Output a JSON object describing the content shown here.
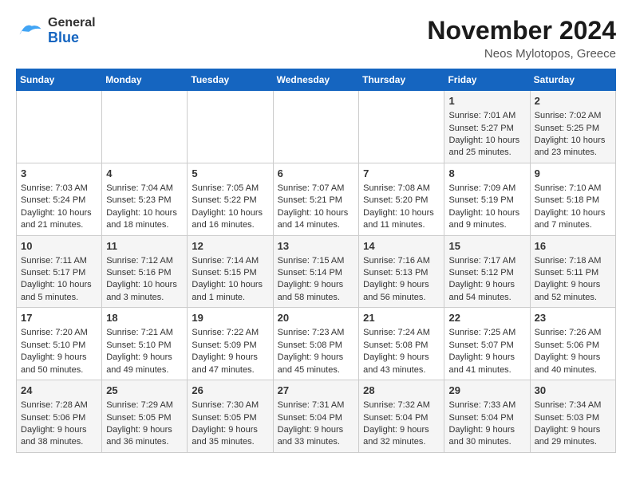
{
  "header": {
    "logo_general": "General",
    "logo_blue": "Blue",
    "month_year": "November 2024",
    "location": "Neos Mylotopos, Greece"
  },
  "days_of_week": [
    "Sunday",
    "Monday",
    "Tuesday",
    "Wednesday",
    "Thursday",
    "Friday",
    "Saturday"
  ],
  "weeks": [
    {
      "cells": [
        {
          "day": "",
          "content": ""
        },
        {
          "day": "",
          "content": ""
        },
        {
          "day": "",
          "content": ""
        },
        {
          "day": "",
          "content": ""
        },
        {
          "day": "",
          "content": ""
        },
        {
          "day": "1",
          "content": "Sunrise: 7:01 AM\nSunset: 5:27 PM\nDaylight: 10 hours and 25 minutes."
        },
        {
          "day": "2",
          "content": "Sunrise: 7:02 AM\nSunset: 5:25 PM\nDaylight: 10 hours and 23 minutes."
        }
      ]
    },
    {
      "cells": [
        {
          "day": "3",
          "content": "Sunrise: 7:03 AM\nSunset: 5:24 PM\nDaylight: 10 hours and 21 minutes."
        },
        {
          "day": "4",
          "content": "Sunrise: 7:04 AM\nSunset: 5:23 PM\nDaylight: 10 hours and 18 minutes."
        },
        {
          "day": "5",
          "content": "Sunrise: 7:05 AM\nSunset: 5:22 PM\nDaylight: 10 hours and 16 minutes."
        },
        {
          "day": "6",
          "content": "Sunrise: 7:07 AM\nSunset: 5:21 PM\nDaylight: 10 hours and 14 minutes."
        },
        {
          "day": "7",
          "content": "Sunrise: 7:08 AM\nSunset: 5:20 PM\nDaylight: 10 hours and 11 minutes."
        },
        {
          "day": "8",
          "content": "Sunrise: 7:09 AM\nSunset: 5:19 PM\nDaylight: 10 hours and 9 minutes."
        },
        {
          "day": "9",
          "content": "Sunrise: 7:10 AM\nSunset: 5:18 PM\nDaylight: 10 hours and 7 minutes."
        }
      ]
    },
    {
      "cells": [
        {
          "day": "10",
          "content": "Sunrise: 7:11 AM\nSunset: 5:17 PM\nDaylight: 10 hours and 5 minutes."
        },
        {
          "day": "11",
          "content": "Sunrise: 7:12 AM\nSunset: 5:16 PM\nDaylight: 10 hours and 3 minutes."
        },
        {
          "day": "12",
          "content": "Sunrise: 7:14 AM\nSunset: 5:15 PM\nDaylight: 10 hours and 1 minute."
        },
        {
          "day": "13",
          "content": "Sunrise: 7:15 AM\nSunset: 5:14 PM\nDaylight: 9 hours and 58 minutes."
        },
        {
          "day": "14",
          "content": "Sunrise: 7:16 AM\nSunset: 5:13 PM\nDaylight: 9 hours and 56 minutes."
        },
        {
          "day": "15",
          "content": "Sunrise: 7:17 AM\nSunset: 5:12 PM\nDaylight: 9 hours and 54 minutes."
        },
        {
          "day": "16",
          "content": "Sunrise: 7:18 AM\nSunset: 5:11 PM\nDaylight: 9 hours and 52 minutes."
        }
      ]
    },
    {
      "cells": [
        {
          "day": "17",
          "content": "Sunrise: 7:20 AM\nSunset: 5:10 PM\nDaylight: 9 hours and 50 minutes."
        },
        {
          "day": "18",
          "content": "Sunrise: 7:21 AM\nSunset: 5:10 PM\nDaylight: 9 hours and 49 minutes."
        },
        {
          "day": "19",
          "content": "Sunrise: 7:22 AM\nSunset: 5:09 PM\nDaylight: 9 hours and 47 minutes."
        },
        {
          "day": "20",
          "content": "Sunrise: 7:23 AM\nSunset: 5:08 PM\nDaylight: 9 hours and 45 minutes."
        },
        {
          "day": "21",
          "content": "Sunrise: 7:24 AM\nSunset: 5:08 PM\nDaylight: 9 hours and 43 minutes."
        },
        {
          "day": "22",
          "content": "Sunrise: 7:25 AM\nSunset: 5:07 PM\nDaylight: 9 hours and 41 minutes."
        },
        {
          "day": "23",
          "content": "Sunrise: 7:26 AM\nSunset: 5:06 PM\nDaylight: 9 hours and 40 minutes."
        }
      ]
    },
    {
      "cells": [
        {
          "day": "24",
          "content": "Sunrise: 7:28 AM\nSunset: 5:06 PM\nDaylight: 9 hours and 38 minutes."
        },
        {
          "day": "25",
          "content": "Sunrise: 7:29 AM\nSunset: 5:05 PM\nDaylight: 9 hours and 36 minutes."
        },
        {
          "day": "26",
          "content": "Sunrise: 7:30 AM\nSunset: 5:05 PM\nDaylight: 9 hours and 35 minutes."
        },
        {
          "day": "27",
          "content": "Sunrise: 7:31 AM\nSunset: 5:04 PM\nDaylight: 9 hours and 33 minutes."
        },
        {
          "day": "28",
          "content": "Sunrise: 7:32 AM\nSunset: 5:04 PM\nDaylight: 9 hours and 32 minutes."
        },
        {
          "day": "29",
          "content": "Sunrise: 7:33 AM\nSunset: 5:04 PM\nDaylight: 9 hours and 30 minutes."
        },
        {
          "day": "30",
          "content": "Sunrise: 7:34 AM\nSunset: 5:03 PM\nDaylight: 9 hours and 29 minutes."
        }
      ]
    }
  ]
}
